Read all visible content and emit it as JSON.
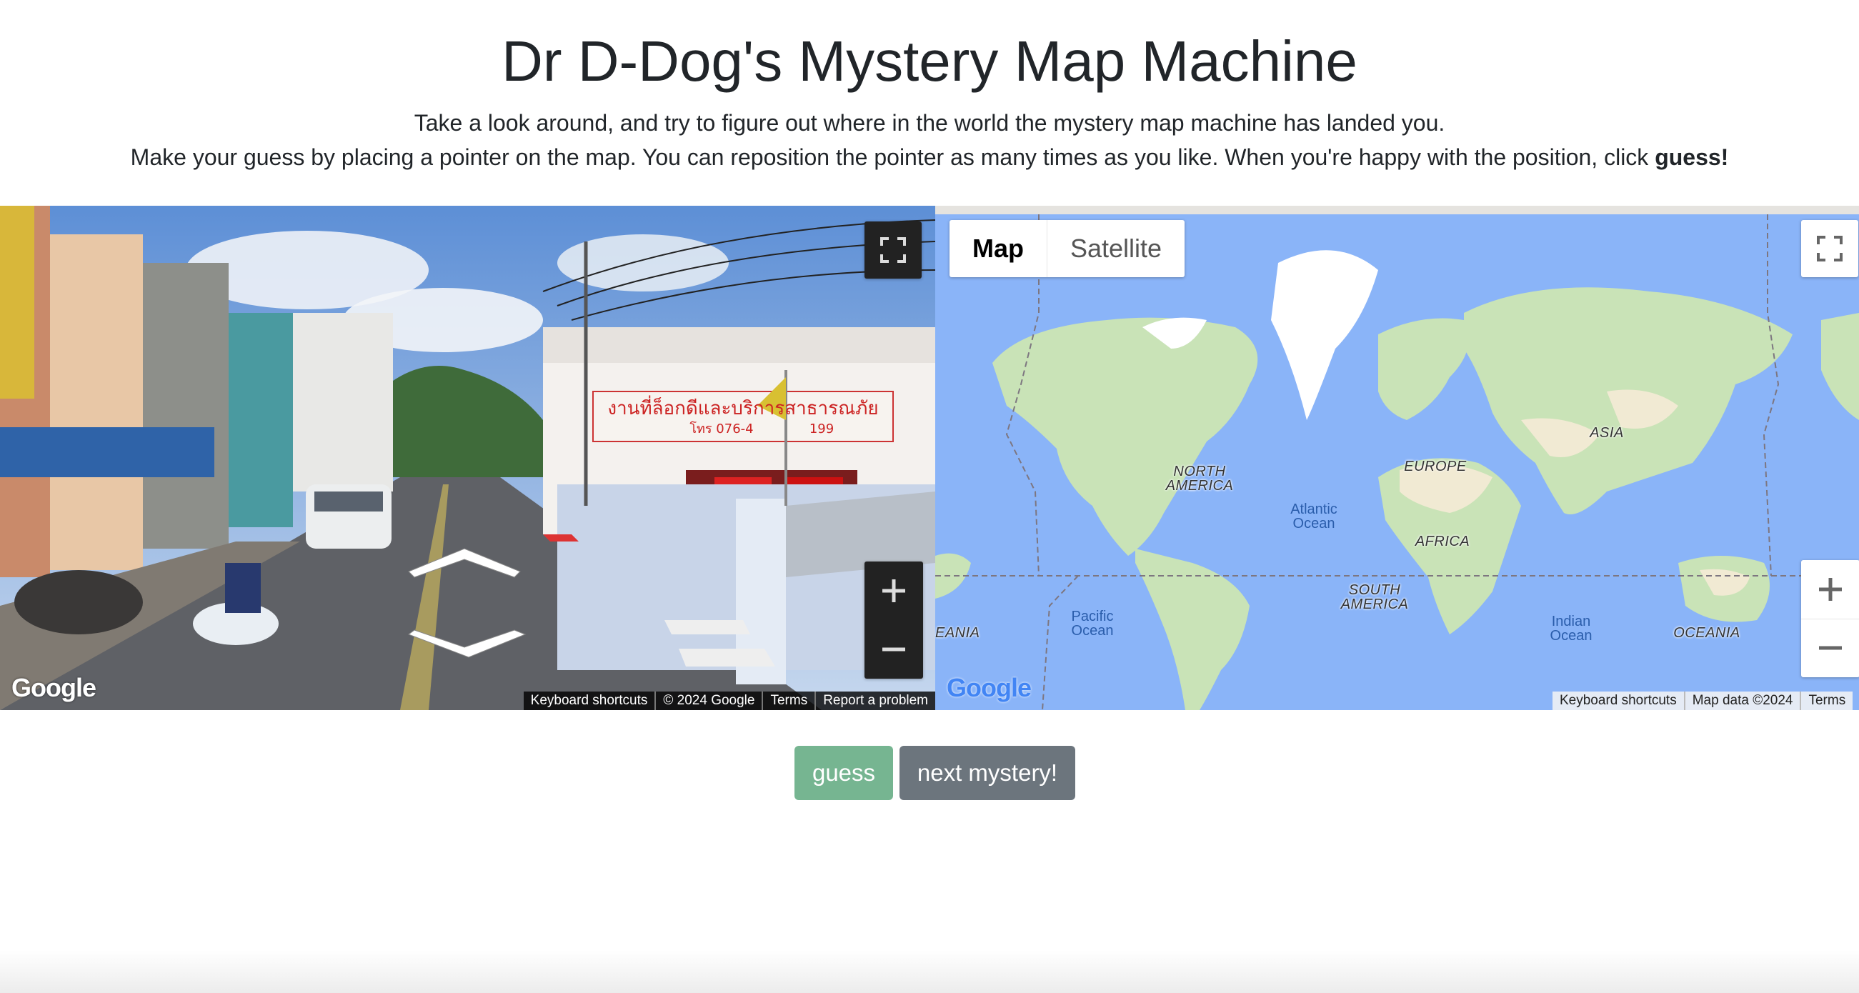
{
  "page": {
    "title": "Dr D-Dog's Mystery Map Machine",
    "intro_line1": "Take a look around, and try to figure out where in the world the mystery map machine has landed you.",
    "intro_line2_prefix": "Make your guess by placing a pointer on the map. You can reposition the pointer as many times as you like. When you're happy with the position, click ",
    "intro_line2_bold": "guess!"
  },
  "street_view": {
    "logo": "Google",
    "sign_text": "งานที่ล็อกดีและบริการสาธารณภัย",
    "sign_phone": "โทร 076-4",
    "sign_number": "199",
    "attribution": [
      "Keyboard shortcuts",
      "© 2024 Google",
      "Terms",
      "Report a problem"
    ],
    "icons": [
      "fullscreen-icon",
      "zoom-in-icon",
      "zoom-out-icon",
      "nav-arrow-forward-icon",
      "nav-arrow-back-icon"
    ]
  },
  "map": {
    "type_control": {
      "map_label": "Map",
      "satellite_label": "Satellite",
      "selected": "Map"
    },
    "labels": {
      "north_america": "NORTH AMERICA",
      "south_america": "SOUTH AMERICA",
      "europe": "EUROPE",
      "africa": "AFRICA",
      "asia": "ASIA",
      "oceania": "OCEANIA",
      "oceania_left": "EANIA",
      "atlantic": "Atlantic Ocean",
      "pacific": "Pacific Ocean",
      "indian": "Indian Ocean"
    },
    "logo": "Google",
    "attribution": [
      "Keyboard shortcuts",
      "Map data ©2024",
      "Terms"
    ],
    "colors": {
      "water": "#8ab4f8",
      "land": "#c9e3b7",
      "ice": "#ffffff"
    }
  },
  "buttons": {
    "guess": "guess",
    "next": "next mystery!"
  },
  "colors": {
    "guess_button": "#6fb28c",
    "next_button": "#6c757d",
    "text": "#212529"
  }
}
